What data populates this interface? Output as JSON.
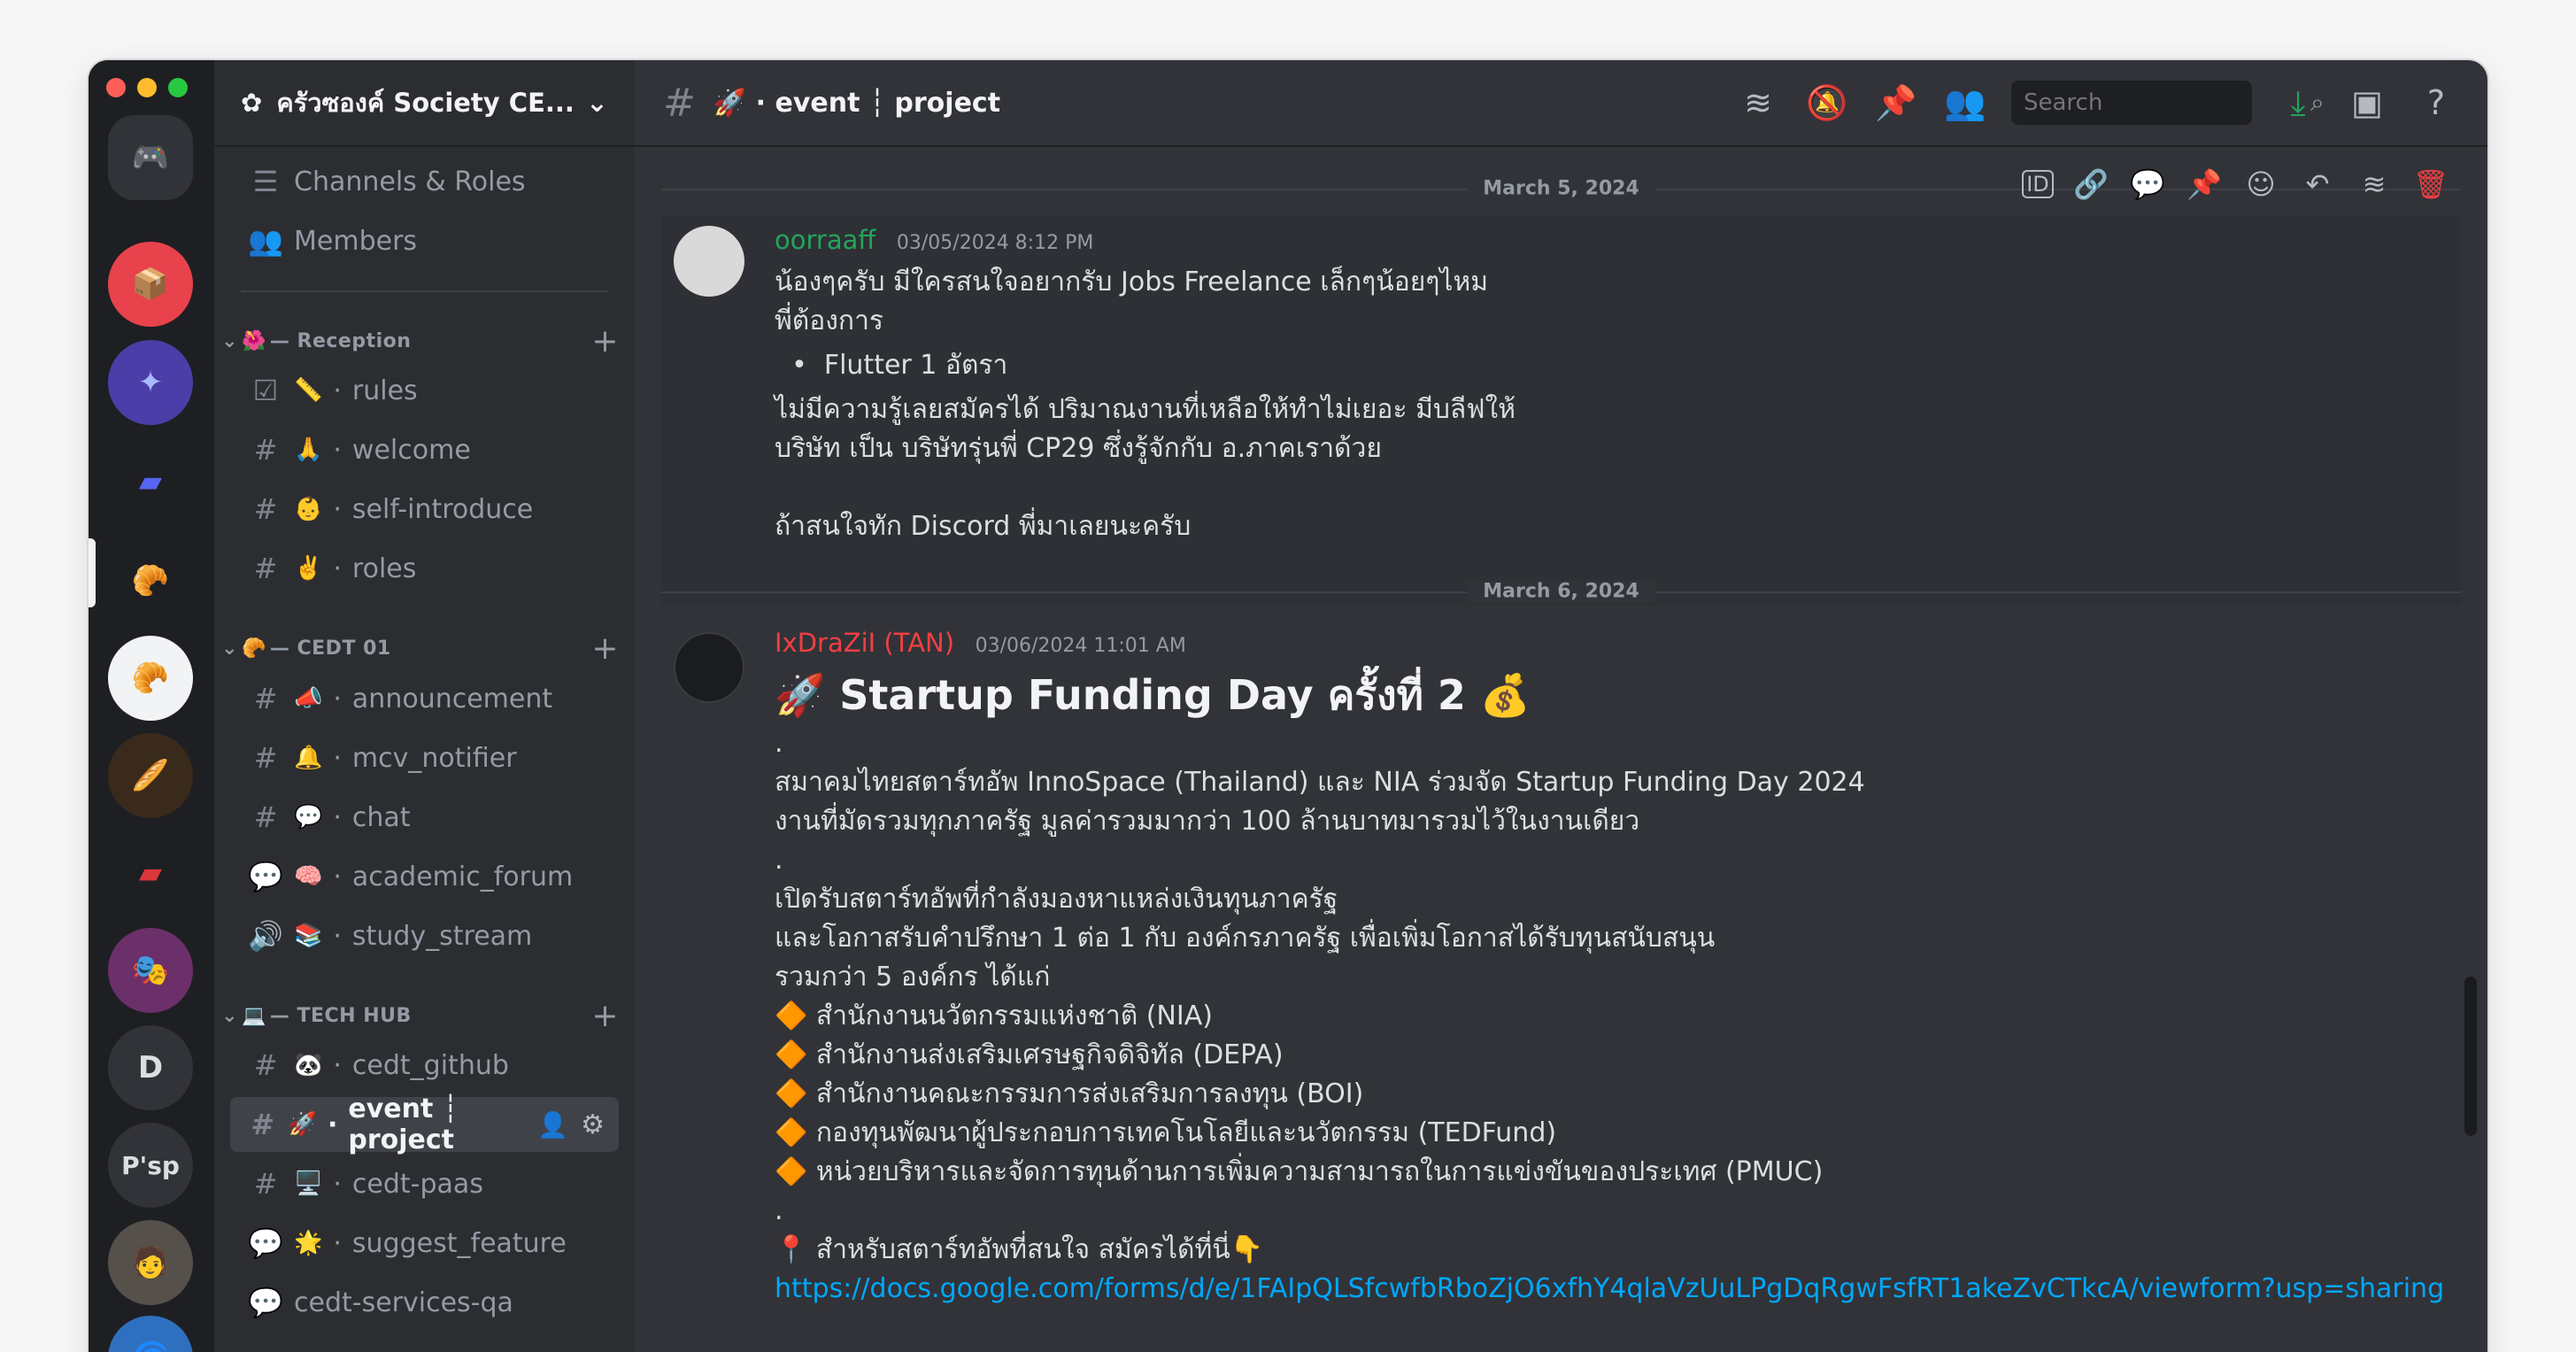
{
  "window": {
    "traffic": [
      "close",
      "minimize",
      "zoom"
    ]
  },
  "rail": {
    "servers": [
      {
        "name": "discord-home",
        "glyph": "🎮",
        "color": "#2b2d31"
      },
      {
        "name": "server-red-box",
        "glyph": "📦",
        "color": "#e8424c"
      },
      {
        "name": "server-blue-swirl",
        "glyph": "✦",
        "color": "#4b3ea8"
      },
      {
        "name": "server-folder-blue",
        "glyph": "▰",
        "color": "#2b2d31"
      },
      {
        "name": "server-croissant",
        "glyph": "🥐",
        "color": "#1e1f22"
      },
      {
        "name": "server-croissant-white",
        "glyph": "🥐",
        "color": "#f2f3f5"
      },
      {
        "name": "server-bread",
        "glyph": "🥖",
        "color": "#3a2a1c"
      },
      {
        "name": "server-folder-red",
        "glyph": "▰",
        "color": "#2b2d31"
      },
      {
        "name": "server-anime",
        "glyph": "🎭",
        "color": "#6b2f6a"
      },
      {
        "name": "server-d",
        "glyph": "D",
        "color": "#2b2d31"
      },
      {
        "name": "server-psp",
        "glyph": "P'sp",
        "color": "#2b2d31"
      },
      {
        "name": "server-photo",
        "glyph": "🧑",
        "color": "#55504a"
      },
      {
        "name": "server-blue",
        "glyph": "🌀",
        "color": "#2f6fc0"
      }
    ]
  },
  "sidebar": {
    "guild_name": "ครัวซองค์ Society CE...",
    "top_items": [
      {
        "icon": "☰",
        "label": "Channels & Roles"
      },
      {
        "icon": "👥",
        "label": "Members"
      }
    ],
    "categories": [
      {
        "label": "— Reception",
        "emoji": "🌺"
      },
      {
        "label": "— CEDT 01",
        "emoji": "🥐"
      },
      {
        "label": "— TECH HUB",
        "emoji": "💻"
      }
    ],
    "channels": [
      {
        "icon": "☑",
        "emoji": "📏",
        "label": "rules"
      },
      {
        "icon": "#",
        "emoji": "🙏",
        "label": "welcome"
      },
      {
        "icon": "#",
        "emoji": "👶",
        "label": "self-introduce"
      },
      {
        "icon": "#",
        "emoji": "✌️",
        "label": "roles"
      },
      {
        "icon": "#",
        "emoji": "📣",
        "label": "announcement"
      },
      {
        "icon": "#",
        "emoji": "🔔",
        "label": "mcv_notifier"
      },
      {
        "icon": "#",
        "emoji": "💬",
        "label": "chat"
      },
      {
        "icon": "💬",
        "emoji": "🧠",
        "label": "academic_forum"
      },
      {
        "icon": "🔊",
        "emoji": "📚",
        "label": "study_stream"
      },
      {
        "icon": "#",
        "emoji": "🐼",
        "label": "cedt_github"
      },
      {
        "icon": "#",
        "emoji": "🚀",
        "label": "event ┆ project"
      },
      {
        "icon": "#",
        "emoji": "🖥️",
        "label": "cedt-paas"
      },
      {
        "icon": "💬",
        "emoji": "🌟",
        "label": "suggest_feature"
      },
      {
        "icon": "💬",
        "emoji": "",
        "label": "cedt-services-qa"
      }
    ]
  },
  "topbar": {
    "channel_title": "🚀 · event ┆ project",
    "search_placeholder": "Search"
  },
  "messages": [
    {
      "date": "March 5, 2024",
      "author": "oorraaff",
      "author_color": "#23a55a",
      "timestamp": "03/05/2024 8:12 PM",
      "lines": [
        "น้องๆครับ มีใครสนใจอยากรับ Jobs Freelance เล็กๆน้อยๆไหม",
        "พี่ต้องการ",
        "  •  Flutter 1 อัตรา",
        "ไม่มีความรู้เลยสมัครได้ ปริมาณงานที่เหลือให้ทำไม่เยอะ มีบลีฟให้",
        "บริษัท เป็น บริษัทรุ่นพี่ CP29 ซึ่งรู้จักกับ อ.ภาคเราด้วย",
        "",
        "ถ้าสนใจทัก Discord พี่มาเลยนะครับ"
      ]
    },
    {
      "date": "March 6, 2024",
      "author": "IxDraZiI (TAN)",
      "author_color": "#f23f42",
      "timestamp": "03/06/2024 11:01 AM",
      "heading": "🚀 Startup Funding Day ครั้งที่ 2 💰",
      "lines": [
        ".",
        "สมาคมไทยสตาร์ทอัพ InnoSpace (Thailand) และ NIA ร่วมจัด Startup Funding Day 2024",
        "งานที่มัดรวมทุกภาครัฐ มูลค่ารวมมากว่า 100 ล้านบาทมารวมไว้ในงานเดียว",
        ".",
        "เปิดรับสตาร์ทอัพที่กำลังมองหาแหล่งเงินทุนภาครัฐ",
        "และโอกาสรับคำปรึกษา 1 ต่อ 1 กับ องค์กรภาครัฐ เพื่อเพิ่มโอกาสได้รับทุนสนับสนุน",
        "รวมกว่า 5 องค์กร ได้แก่",
        "🔶 สำนักงานนวัตกรรมแห่งชาติ (NIA)",
        "🔶 สำนักงานส่งเสริมเศรษฐกิจดิจิทัล (DEPA)",
        "🔶 สำนักงานคณะกรรมการส่งเสริมการลงทุน (BOI)",
        "🔶 กองทุนพัฒนาผู้ประกอบการเทคโนโลยีและนวัตกรรม (TEDFund)",
        "🔶 หน่วยบริหารและจัดการทุนด้านการเพิ่มความสามารถในการแข่งขันของประเทศ (PMUC)",
        ".",
        "📍 สำหรับสตาร์ทอัพที่สนใจ สมัครได้ที่นี่👇"
      ],
      "link": "https://docs.google.com/forms/d/e/1FAIpQLSfcwfbRboZjO6xfhY4qlaVzUuLPgDqRgwFsfRT1akeZvCTkcA/viewform?usp=sharing"
    }
  ],
  "colors": {
    "bg_main": "#313338",
    "bg_sidebar": "#2b2d31",
    "bg_rail": "#1e1f22",
    "link": "#00a8fc",
    "delete": "#f23f42",
    "download": "#23a55a"
  }
}
